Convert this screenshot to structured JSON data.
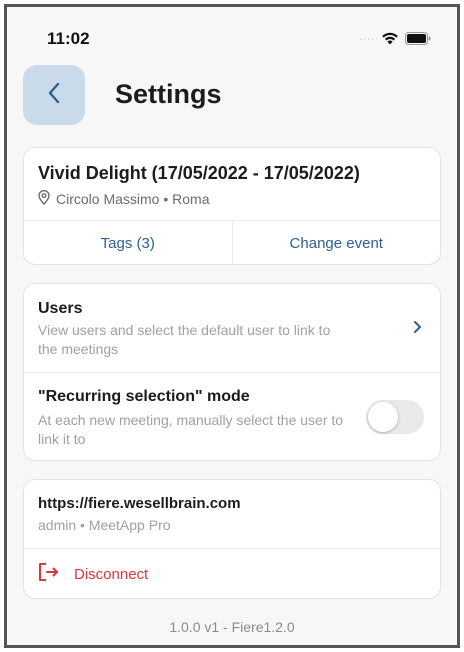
{
  "status_bar": {
    "time": "11:02",
    "signal": "....",
    "icons": [
      "wifi-icon",
      "battery-icon"
    ]
  },
  "header": {
    "back_icon": "chevron-left-icon",
    "title": "Settings"
  },
  "event": {
    "title": "Vivid Delight (17/05/2022 - 17/05/2022)",
    "location_icon": "location-pin-icon",
    "location": "Circolo Massimo • Roma",
    "tags_label": "Tags (3)",
    "change_label": "Change event"
  },
  "users": {
    "title": "Users",
    "description": "View users and select the default user to link to the meetings",
    "chevron_icon": "chevron-right-icon"
  },
  "recurring": {
    "title": "\"Recurring selection\" mode",
    "description": "At each new meeting, manually select the user to link it to",
    "enabled": false
  },
  "account": {
    "url": "https://fiere.wesellbrain.com",
    "meta": "admin • MeetApp Pro",
    "disconnect_icon": "logout-icon",
    "disconnect_label": "Disconnect"
  },
  "version": "1.0.0 v1 -  Fiere1.2.0",
  "colors": {
    "accent": "#2f5f8f",
    "back_button_bg": "#c9dbea",
    "danger": "#d9363e",
    "toggle_off": "#e9e9eb",
    "secondary_text": "#a0a0a5",
    "background": "#f7f7f8"
  }
}
